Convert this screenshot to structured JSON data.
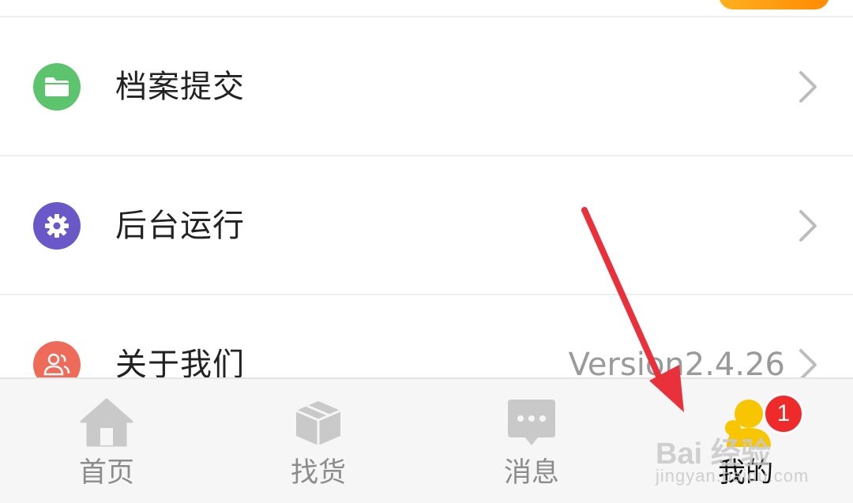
{
  "menu": {
    "items": [
      {
        "label": "档案提交",
        "icon": "folder-icon",
        "color": "#5cc46c"
      },
      {
        "label": "后台运行",
        "icon": "gear-icon",
        "color": "#6a58c9"
      },
      {
        "label": "关于我们",
        "icon": "users-icon",
        "color": "#ee6b5a",
        "value": "Version2.4.26"
      }
    ]
  },
  "tabbar": {
    "tabs": [
      {
        "label": "首页",
        "icon": "home-icon"
      },
      {
        "label": "找货",
        "icon": "box-icon"
      },
      {
        "label": "消息",
        "icon": "message-icon"
      },
      {
        "label": "我的",
        "icon": "profile-icon",
        "active": true,
        "badge": "1"
      }
    ]
  },
  "colors": {
    "active_tab": "#f7c600",
    "inactive_tab": "#c9c9c9",
    "badge": "#ee2a2a",
    "annotation_arrow": "#e8313a"
  },
  "watermark": {
    "brand": "Bai 经验",
    "url": "jingyan.baidu.com"
  }
}
